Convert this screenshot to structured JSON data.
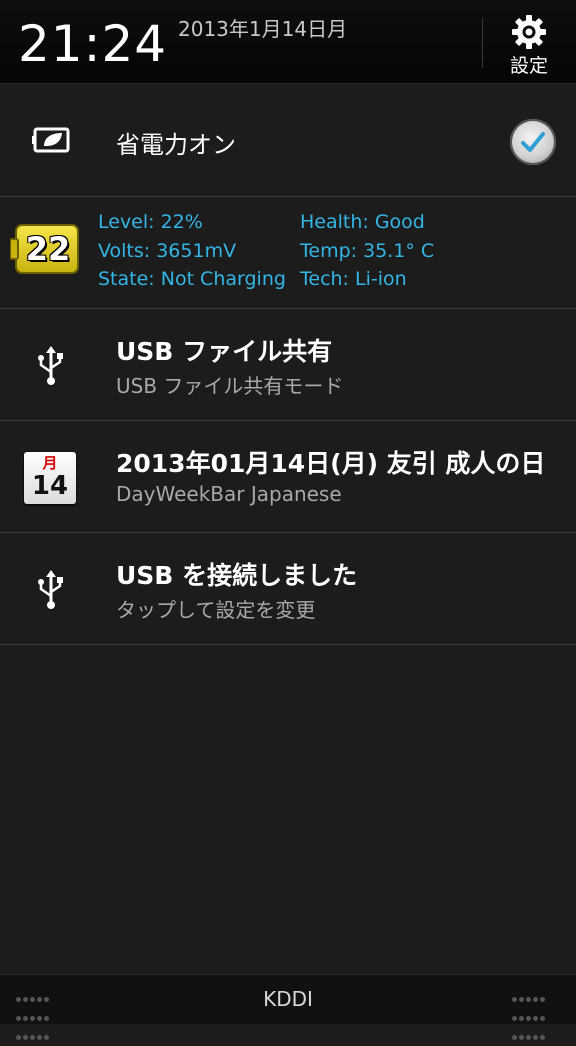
{
  "header": {
    "time": "21:24",
    "date": "2013年1月14日月",
    "settings_label": "設定"
  },
  "notifications": {
    "power": {
      "label": "省電力オン",
      "checked": true
    },
    "battery": {
      "badge": "22",
      "level": "Level: 22%",
      "volts": "Volts: 3651mV",
      "state": "State: Not Charging",
      "health": "Health: Good",
      "temp": "Temp: 35.1° C",
      "tech": "Tech: Li-ion"
    },
    "usb_share": {
      "title": "USB ファイル共有",
      "subtitle": "USB ファイル共有モード"
    },
    "calendar": {
      "month": "月",
      "day": "14",
      "title": "2013年01月14日(月) 友引 成人の日",
      "subtitle": "DayWeekBar Japanese"
    },
    "usb_connected": {
      "title": "USB を接続しました",
      "subtitle": "タップして設定を変更"
    }
  },
  "footer": {
    "carrier": "KDDI"
  },
  "colors": {
    "accent": "#33b5e5",
    "background": "#1c1c1c",
    "battery_badge": "#e8d21e"
  }
}
